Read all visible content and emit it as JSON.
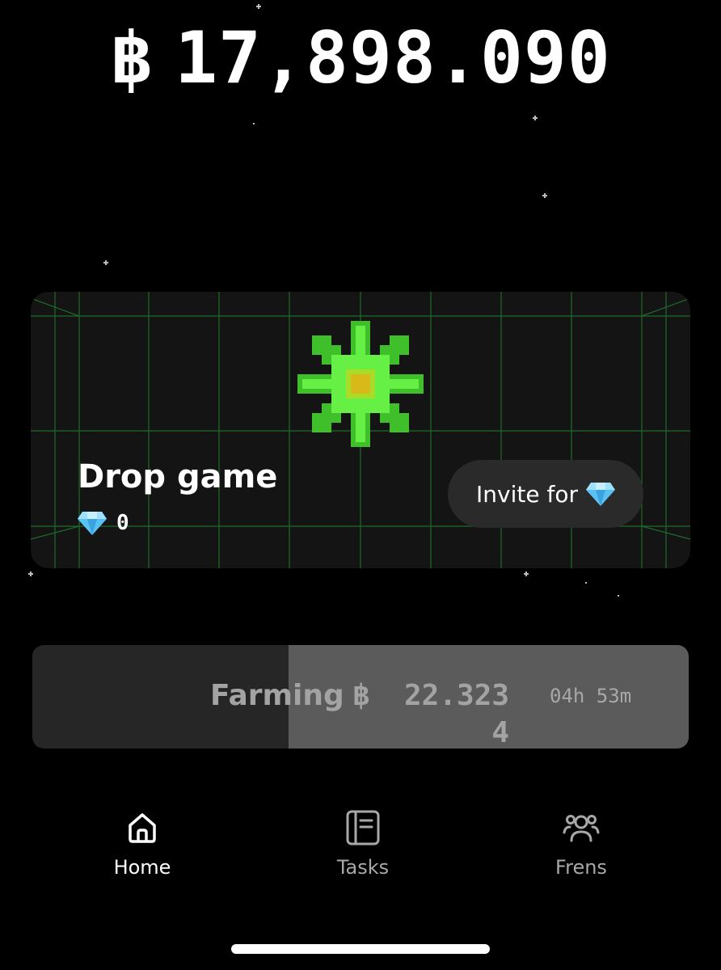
{
  "balance": {
    "currency_symbol": "฿",
    "amount": "17,898.090"
  },
  "drop_game": {
    "title": "Drop game",
    "gem_count": "0",
    "invite_label": "Invite for",
    "invite_icon": "diamond-icon",
    "logo_icon": "pixel-star-logo"
  },
  "farming": {
    "label": "Farming",
    "currency_symbol": "฿",
    "amount": "22.3234",
    "timer": "04h 53m",
    "progress_fraction": 0.61
  },
  "nav": {
    "items": [
      {
        "label": "Home",
        "icon": "home-icon",
        "active": true
      },
      {
        "label": "Tasks",
        "icon": "notebook-icon",
        "active": false
      },
      {
        "label": "Frens",
        "icon": "friends-icon",
        "active": false
      }
    ]
  },
  "colors": {
    "background": "#000000",
    "card": "#141414",
    "grid": "#1f6b2a",
    "logo_green": "#57e33a",
    "logo_center": "#d9c21a",
    "gem_blue": "#66ccff",
    "farm_track": "#262626",
    "farm_fill": "#5b5b5b"
  }
}
